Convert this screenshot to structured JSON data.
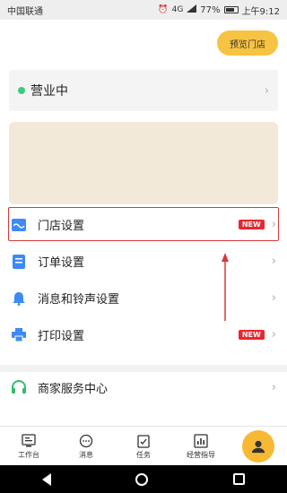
{
  "status_bar": {
    "carrier": "中国联通",
    "battery": "77%",
    "battery_level": 0.77,
    "time": "上午9:12",
    "signal_label": "4G"
  },
  "header": {
    "preview_button": "预览门店"
  },
  "shop_status": {
    "label": "营业中",
    "dot_color": "#3fca7f"
  },
  "menu": {
    "items": [
      {
        "label": "门店设置",
        "badge": "NEW",
        "icon": "store-icon"
      },
      {
        "label": "订单设置",
        "badge": "",
        "icon": "order-icon"
      },
      {
        "label": "消息和铃声设置",
        "badge": "",
        "icon": "bell-icon"
      },
      {
        "label": "打印设置",
        "badge": "NEW",
        "icon": "printer-icon"
      }
    ],
    "service": {
      "label": "商家服务中心",
      "icon": "headset-icon"
    }
  },
  "tabbar": {
    "tabs": [
      {
        "label": "工作台",
        "icon": "workbench-icon"
      },
      {
        "label": "消息",
        "icon": "message-icon"
      },
      {
        "label": "任务",
        "icon": "task-icon"
      },
      {
        "label": "经营指导",
        "icon": "chart-icon"
      }
    ]
  },
  "colors": {
    "accent": "#f7c343",
    "badge": "#e8272f",
    "highlight": "#d73a3a",
    "icon_blue": "#3d8af7"
  }
}
